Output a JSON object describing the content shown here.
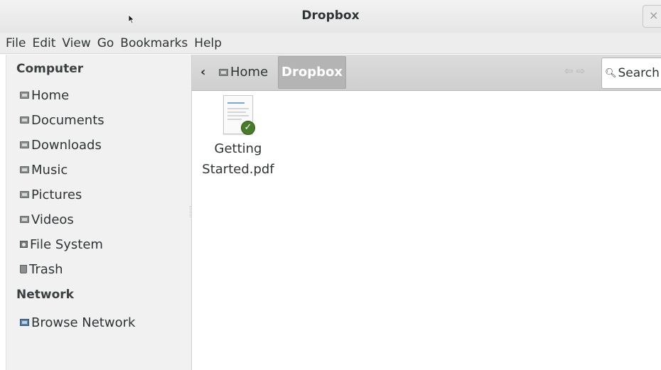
{
  "window": {
    "title": "Dropbox",
    "close_glyph": "×"
  },
  "menubar": {
    "items": [
      "File",
      "Edit",
      "View",
      "Go",
      "Bookmarks",
      "Help"
    ]
  },
  "sidebar": {
    "sections": [
      {
        "heading": "Computer",
        "items": [
          {
            "label": "Home",
            "icon": "home-folder-icon"
          },
          {
            "label": "Documents",
            "icon": "documents-folder-icon"
          },
          {
            "label": "Downloads",
            "icon": "downloads-folder-icon"
          },
          {
            "label": "Music",
            "icon": "music-folder-icon"
          },
          {
            "label": "Pictures",
            "icon": "pictures-folder-icon"
          },
          {
            "label": "Videos",
            "icon": "videos-folder-icon"
          },
          {
            "label": "File System",
            "icon": "drive-icon"
          },
          {
            "label": "Trash",
            "icon": "trash-icon"
          }
        ]
      },
      {
        "heading": "Network",
        "items": [
          {
            "label": "Browse Network",
            "icon": "network-icon"
          }
        ]
      }
    ]
  },
  "pathbar": {
    "back_glyph": "‹",
    "home_label": "Home",
    "current_label": "Dropbox",
    "nav_arrows": "⇦⇨",
    "search_placeholder": "Search"
  },
  "files": [
    {
      "name": "Getting\nStarted.pdf",
      "type": "pdf",
      "status": "synced"
    }
  ]
}
